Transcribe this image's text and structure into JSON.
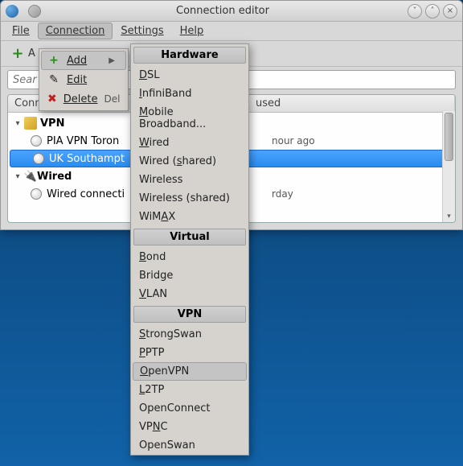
{
  "window": {
    "title": "Connection editor"
  },
  "menubar": {
    "file": "File",
    "connection": "Connection",
    "settings": "Settings",
    "help": "Help"
  },
  "toolbar": {
    "add_label": "A"
  },
  "search": {
    "placeholder": "Sear"
  },
  "columns": {
    "name": "Conn",
    "used": "used"
  },
  "groups": {
    "vpn": {
      "label": "VPN"
    },
    "wired": {
      "label": "Wired"
    }
  },
  "connections": {
    "pia": {
      "label": "PIA VPN Toron",
      "used": "nour ago"
    },
    "uk": {
      "label": "UK Southampt",
      "used": ""
    },
    "wiredc": {
      "label": "Wired connecti",
      "used": "rday"
    }
  },
  "conn_menu": {
    "add": "Add",
    "edit": "Edit",
    "delete": "Delete",
    "delete_shortcut": "Del"
  },
  "submenu": {
    "headers": {
      "hardware": "Hardware",
      "virtual": "Virtual",
      "vpn": "VPN"
    },
    "hardware": {
      "dsl": "DSL",
      "infiniband": "InfiniBand",
      "mobile": "Mobile Broadband...",
      "wired": "Wired",
      "wired_shared": "Wired (shared)",
      "wireless": "Wireless",
      "wireless_shared": "Wireless (shared)",
      "wimax": "WiMAX"
    },
    "virtual": {
      "bond": "Bond",
      "bridge": "Bridge",
      "vlan": "VLAN"
    },
    "vpn": {
      "strongswan": "StrongSwan",
      "pptp": "PPTP",
      "openvpn": "OpenVPN",
      "l2tp": "L2TP",
      "openconnect": "OpenConnect",
      "vpnc": "VPNC",
      "openswan": "OpenSwan"
    }
  }
}
